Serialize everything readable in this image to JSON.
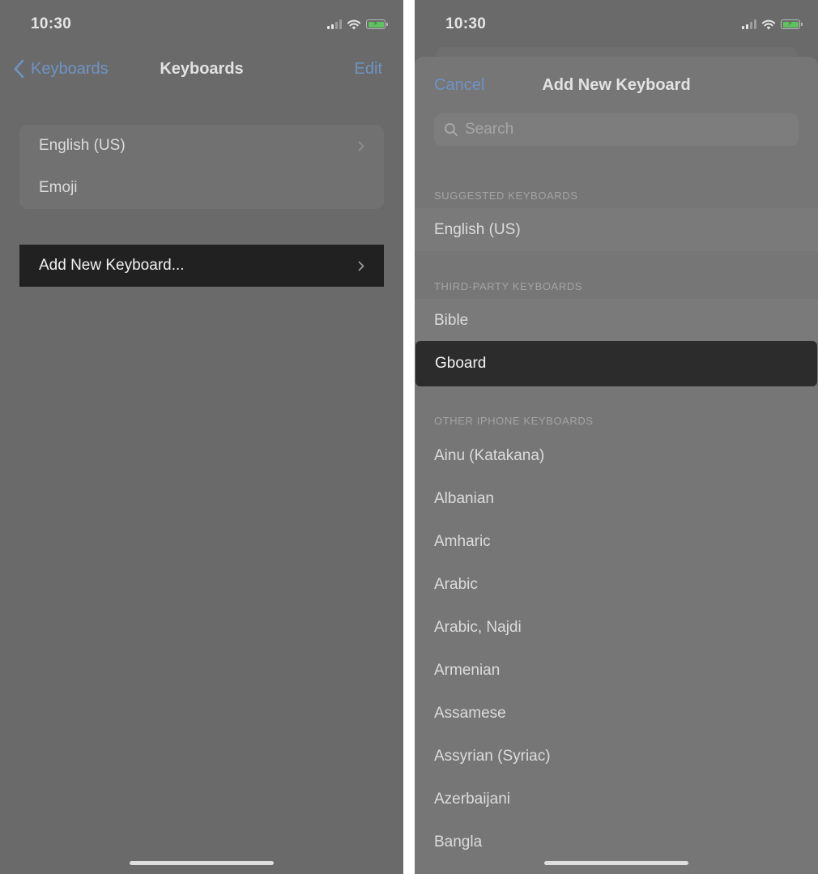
{
  "left": {
    "status": {
      "time": "10:30"
    },
    "nav": {
      "back_label": "Keyboards",
      "title": "Keyboards",
      "edit_label": "Edit"
    },
    "keyboards": [
      {
        "label": "English (US)",
        "has_chevron": true
      },
      {
        "label": "Emoji",
        "has_chevron": false
      }
    ],
    "add_new_label": "Add New Keyboard..."
  },
  "right": {
    "status": {
      "time": "10:30"
    },
    "sheet": {
      "cancel_label": "Cancel",
      "title": "Add New Keyboard",
      "search_placeholder": "Search"
    },
    "sections": {
      "suggested_header": "SUGGESTED KEYBOARDS",
      "suggested": [
        "English (US)"
      ],
      "third_party_header": "THIRD-PARTY KEYBOARDS",
      "third_party": [
        "Bible",
        "Gboard"
      ],
      "third_party_selected": "Gboard",
      "other_header": "OTHER IPHONE KEYBOARDS",
      "other": [
        "Ainu (Katakana)",
        "Albanian",
        "Amharic",
        "Arabic",
        "Arabic, Najdi",
        "Armenian",
        "Assamese",
        "Assyrian (Syriac)",
        "Azerbaijani",
        "Bangla"
      ]
    }
  },
  "colors": {
    "background": "#6a6a6a",
    "link": "#6f93c4",
    "selected_row": "#2c2c2c",
    "battery_fill": "#5fc15f"
  },
  "icons": [
    "cellular-signal-icon",
    "wifi-icon",
    "battery-charging-icon",
    "chevron-left-icon",
    "chevron-right-icon",
    "search-icon"
  ]
}
